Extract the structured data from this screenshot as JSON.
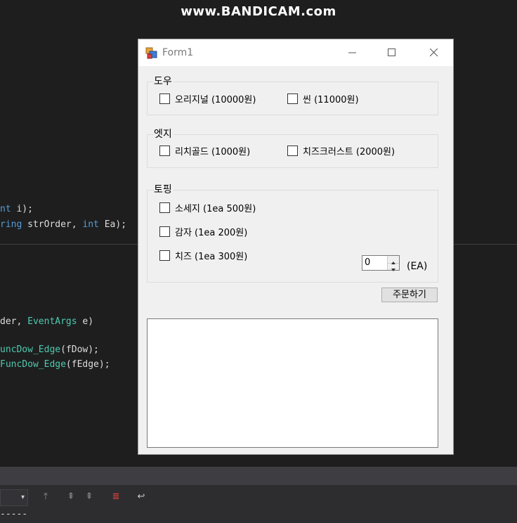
{
  "watermark": "www.BANDICAM.com",
  "background_code": {
    "line1": {
      "kw": "nt",
      "rest": " i);"
    },
    "line2": {
      "kw1": "ring",
      "mid": " strOrder, ",
      "kw2": "int",
      "rest": " Ea);"
    },
    "line3": {
      "pre": "der, ",
      "ty": "EventArgs",
      "rest": " e)"
    },
    "line4": {
      "ty": "uncDow_Edge",
      "rest": "(fDow);"
    },
    "line5": {
      "ty": "FuncDow_Edge",
      "rest": "(fEdge);"
    },
    "bottom_dashes": "-----"
  },
  "window": {
    "title": "Form1",
    "controls": {
      "minimize": "minimize",
      "maximize": "maximize",
      "close": "close"
    }
  },
  "dough": {
    "label": "도우",
    "options": [
      "오리지널 (10000원)",
      "씬 (11000원)"
    ]
  },
  "edge": {
    "label": "엣지",
    "options": [
      "리치골드 (1000원)",
      "치즈크러스트 (2000원)"
    ]
  },
  "topping": {
    "label": "토핑",
    "options": [
      "소세지 (1ea 500원)",
      "감자 (1ea 200원)",
      "치즈 (1ea 300원)"
    ]
  },
  "quantity": {
    "value": "0",
    "unit": "(EA)"
  },
  "order_button": "주문하기",
  "result_text": "",
  "colors": {
    "ide_bg": "#1e1e1e",
    "form_bg": "#f0f0f0",
    "keyword": "#569cd6",
    "type": "#4ec9b0"
  }
}
